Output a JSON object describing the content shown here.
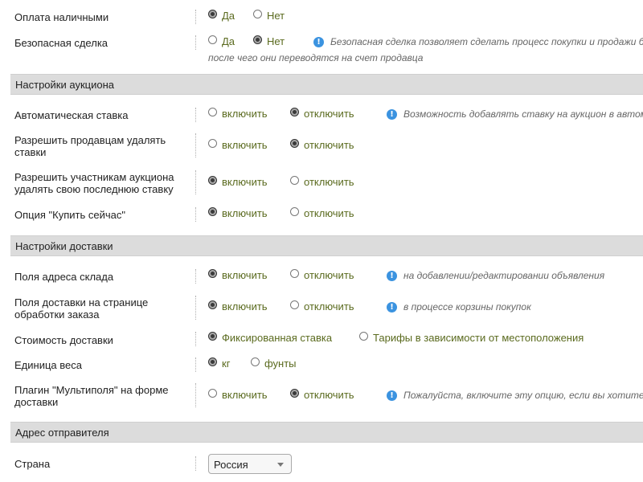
{
  "rows": {
    "cash_payment": {
      "label": "Оплата наличными",
      "options": [
        "Да",
        "Нет"
      ],
      "selected": 0
    },
    "safe_deal": {
      "label": "Безопасная сделка",
      "options": [
        "Да",
        "Нет"
      ],
      "selected": 1,
      "hint_line1": "Безопасная сделка позволяет сделать процесс покупки и продажи бе",
      "hint_line2": "после чего они переводятся на счет продавца"
    },
    "auto_bid": {
      "label": "Автоматическая ставка",
      "options": [
        "включить",
        "отключить"
      ],
      "selected": 1,
      "hint": "Возможность добавлять ставку на аукцион в автома"
    },
    "sellers_delete": {
      "label": "Разрешить продавцам удалять ставки",
      "options": [
        "включить",
        "отключить"
      ],
      "selected": 1
    },
    "bidders_delete": {
      "label": "Разрешить участникам аукциона удалять свою последнюю ставку",
      "options": [
        "включить",
        "отключить"
      ],
      "selected": 0
    },
    "buy_now": {
      "label": "Опция \"Купить сейчас\"",
      "options": [
        "включить",
        "отключить"
      ],
      "selected": 0
    },
    "warehouse_fields": {
      "label": "Поля адреса склада",
      "options": [
        "включить",
        "отключить"
      ],
      "selected": 0,
      "hint": "на добавлении/редактировании объявления"
    },
    "order_fields": {
      "label": "Поля доставки на странице обработки заказа",
      "options": [
        "включить",
        "отключить"
      ],
      "selected": 0,
      "hint": "в процессе корзины покупок"
    },
    "shipping_cost": {
      "label": "Стоимость доставки",
      "options": [
        "Фиксированная ставка",
        "Тарифы в зависимости от местоположения"
      ],
      "selected": 0
    },
    "weight_unit": {
      "label": "Единица веса",
      "options": [
        "кг",
        "фунты"
      ],
      "selected": 0
    },
    "multifield_plugin": {
      "label": "Плагин \"Мультиполя\" на форме доставки",
      "options": [
        "включить",
        "отключить"
      ],
      "selected": 1,
      "hint": "Пожалуйста, включите эту опцию, если вы хотите и"
    },
    "country": {
      "label": "Страна",
      "value": "Россия"
    }
  },
  "sections": {
    "auction": "Настройки аукциона",
    "delivery": "Настройки доставки",
    "sender": "Адрес отправителя"
  },
  "colors": {
    "option_text": "#5a6a1e",
    "section_bg": "#dcdcdc",
    "info_icon": "#3b93e0"
  },
  "icons": {
    "info": "info-icon",
    "select_caret": "chevron-down-icon"
  }
}
